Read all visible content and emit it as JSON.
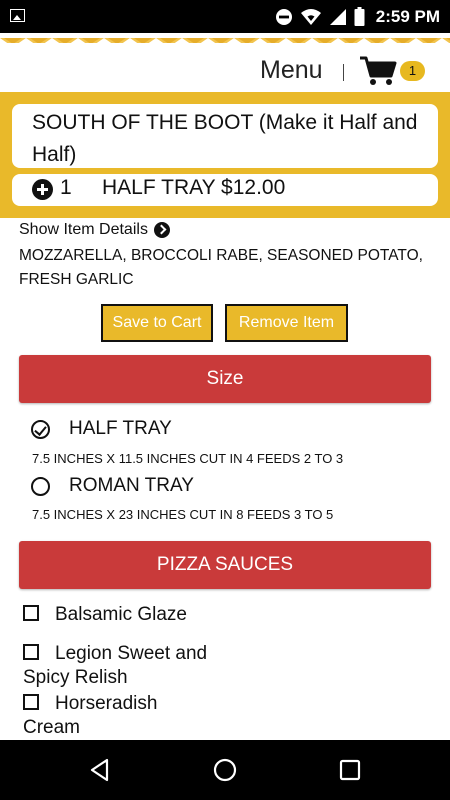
{
  "status_bar": {
    "time": "2:59 PM"
  },
  "header": {
    "title": "Menu",
    "cart_count": "1"
  },
  "product": {
    "name": "SOUTH OF THE BOOT (Make it Half and Half)",
    "quantity": "1",
    "tray_price": "HALF TRAY $12.00"
  },
  "details": {
    "toggle_label": "Show Item Details",
    "ingredients": "MOZZARELLA, BROCCOLI RABE, SEASONED POTATO, FRESH GARLIC"
  },
  "actions": {
    "save_label": "Save to Cart",
    "remove_label": "Remove Item"
  },
  "size_section": {
    "title": "Size",
    "options": [
      {
        "label": "HALF TRAY",
        "description": "7.5 INCHES X 11.5 INCHES CUT IN 4 FEEDS 2 TO 3",
        "selected": true
      },
      {
        "label": "ROMAN TRAY",
        "description": "7.5 INCHES X 23 INCHES CUT IN 8 FEEDS 3 TO 5",
        "selected": false
      }
    ]
  },
  "sauces_section": {
    "title": "PIZZA SAUCES",
    "options": [
      {
        "label": "Balsamic Glaze",
        "checked": false
      },
      {
        "label": "Legion Sweet and Spicy Relish",
        "checked": false
      },
      {
        "label": "Horseradish Cream",
        "checked": false
      }
    ]
  },
  "colors": {
    "accent_yellow": "#e9b92a",
    "section_red": "#c93a3a",
    "badge_yellow": "#e7b81f"
  },
  "icons": [
    "image-icon",
    "dnd-icon",
    "wifi-icon",
    "signal-icon",
    "battery-icon",
    "cart-icon",
    "plus-circle-icon",
    "arrow-circle-right-icon",
    "check-icon",
    "back-icon",
    "home-icon",
    "recents-icon"
  ]
}
